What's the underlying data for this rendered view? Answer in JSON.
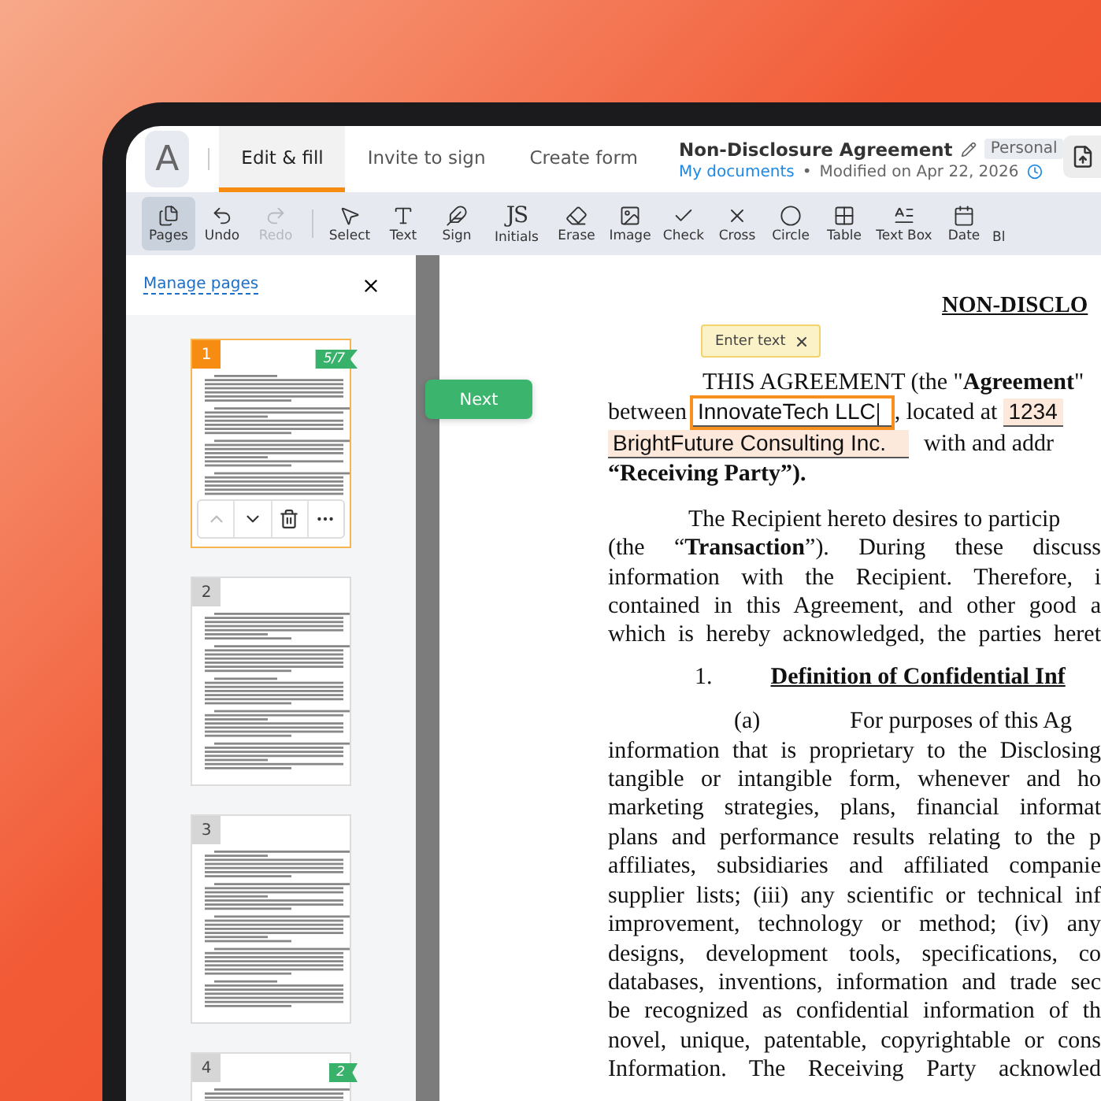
{
  "header": {
    "avatar": "A",
    "tabs": [
      {
        "label": "Edit & fill",
        "selected": true
      },
      {
        "label": "Invite to sign",
        "selected": false
      },
      {
        "label": "Create form",
        "selected": false
      }
    ],
    "doc_title": "Non-Disclosure Agreement",
    "badge": "Personal",
    "breadcrumb": "My documents",
    "separator": "•",
    "modified": "Modified on Apr 22, 2026"
  },
  "toolbar": [
    {
      "label": "Pages",
      "selected": true,
      "disabled": false
    },
    {
      "label": "Undo",
      "selected": false,
      "disabled": false
    },
    {
      "label": "Redo",
      "selected": false,
      "disabled": true
    },
    {
      "label": "Select",
      "selected": false,
      "disabled": false
    },
    {
      "label": "Text",
      "selected": false,
      "disabled": false
    },
    {
      "label": "Sign",
      "selected": false,
      "disabled": false
    },
    {
      "label": "Initials",
      "glyph": "JS",
      "selected": false,
      "disabled": false
    },
    {
      "label": "Erase",
      "selected": false,
      "disabled": false
    },
    {
      "label": "Image",
      "selected": false,
      "disabled": false
    },
    {
      "label": "Check",
      "selected": false,
      "disabled": false
    },
    {
      "label": "Cross",
      "selected": false,
      "disabled": false
    },
    {
      "label": "Circle",
      "selected": false,
      "disabled": false
    },
    {
      "label": "Table",
      "selected": false,
      "disabled": false
    },
    {
      "label": "Text Box",
      "selected": false,
      "disabled": false
    },
    {
      "label": "Date",
      "selected": false,
      "disabled": false
    },
    {
      "label": "Bl",
      "selected": false,
      "disabled": false
    }
  ],
  "sidebar": {
    "title": "Manage pages",
    "pages": [
      {
        "number": "1",
        "selected": true,
        "flag": "5/7"
      },
      {
        "number": "2",
        "selected": false
      },
      {
        "number": "3",
        "selected": false
      },
      {
        "number": "4",
        "selected": false,
        "flag": "2"
      }
    ]
  },
  "next_button": "Next",
  "document": {
    "title": "NON-DISCLO",
    "tooltip": "Enter text",
    "intro": "THIS AGREEMENT (the \"**Agreement**\"",
    "between": "between",
    "field_1": {
      "value": "InnovateTech LLC",
      "active": true
    },
    "located": ", located at",
    "field_2": {
      "value": "1234",
      "active": false
    },
    "field_3": {
      "value": "BrightFuture Consulting Inc.",
      "active": false
    },
    "with": "with and addr",
    "receiving": "“Receiving Party”).",
    "paragraph": [
      "The Recipient hereto desires to particip",
      "(the “**Transaction**”).  During these discuss",
      "information with the Recipient.  Therefore, i",
      "contained in this Agreement, and other good a",
      "which is hereby acknowledged, the parties heret"
    ],
    "section_number": "1.",
    "section_title": "Definition of Confidential Inf",
    "sub_number": "(a)",
    "sub_first": "For purposes of this Ag",
    "sub_lines": [
      "information that is proprietary to the Disclosing",
      "tangible or intangible form, whenever and ho",
      "marketing strategies, plans, financial informat",
      "plans and performance results relating to the p",
      "affiliates, subsidiaries and affiliated companie",
      "supplier lists; (iii) any scientific or technical inf",
      "improvement, technology or method; (iv) any",
      "designs, development tools, specifications, co",
      "databases, inventions, information and trade sec",
      "be recognized as confidential information of th",
      "novel, unique, patentable, copyrightable or cons",
      "Information.  The Receiving Party acknowled"
    ]
  }
}
